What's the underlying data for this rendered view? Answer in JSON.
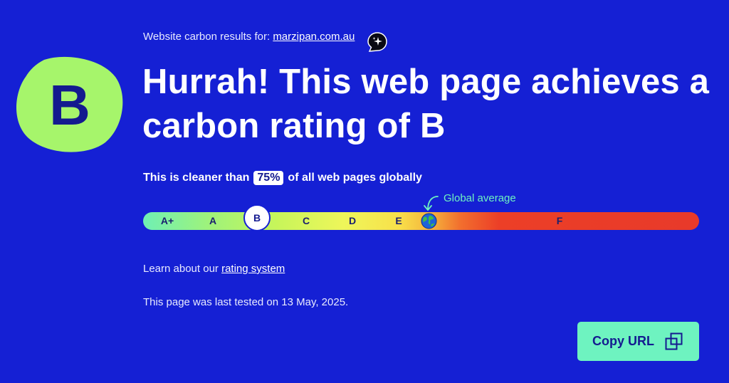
{
  "grade": "B",
  "results": {
    "prefix": "Website carbon results for:",
    "site": "marzipan.com.au"
  },
  "headline": "Hurrah! This web page achieves a carbon rating of B",
  "cleaner": {
    "before": "This is cleaner than",
    "percent": "75%",
    "after": "of all web pages globally"
  },
  "global_average_label": "Global average",
  "scale": {
    "labels": [
      "A+",
      "A",
      "B",
      "C",
      "D",
      "E",
      "F"
    ],
    "current": "B"
  },
  "learn": {
    "prefix": "Learn about our",
    "link": "rating system"
  },
  "tested": "This page was last tested on 13 May, 2025.",
  "copy_button": "Copy URL",
  "colors": {
    "background": "#1520d4",
    "accent": "#6ef3c0",
    "grade_blob": "#a6f56b",
    "dark_text": "#141a8f"
  },
  "icons": {
    "sparkle": "sparkle-chat-icon",
    "globe": "globe-icon",
    "arrow": "curved-arrow-icon",
    "copy": "copy-icon"
  }
}
